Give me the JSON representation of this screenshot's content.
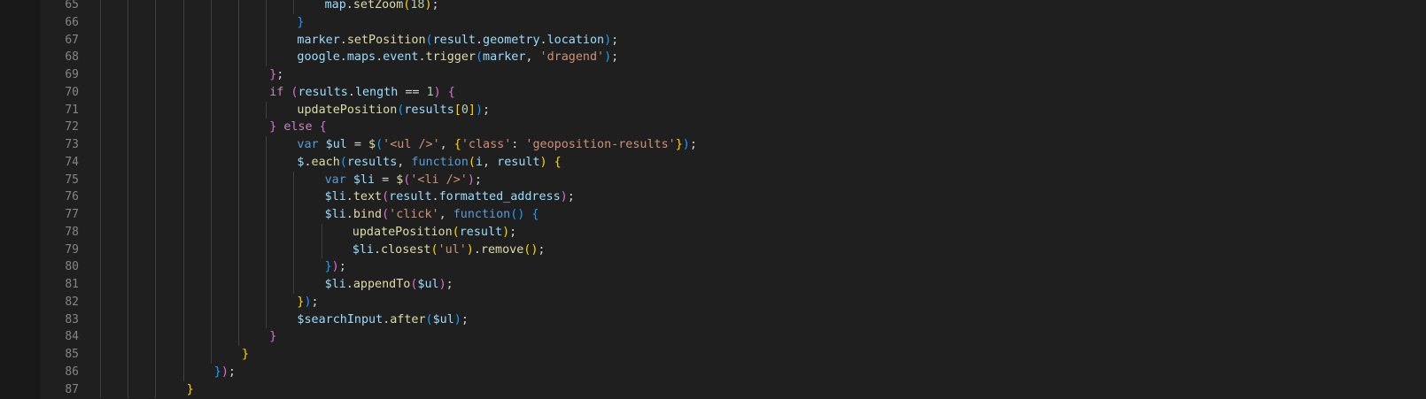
{
  "editor": {
    "language": "javascript",
    "theme": "dark",
    "lines": [
      {
        "num": "65",
        "indent": 8,
        "guides": [
          0,
          1,
          2,
          3,
          4,
          5,
          6,
          7
        ],
        "tokens": [
          {
            "t": "map",
            "c": "t-var"
          },
          {
            "t": ".",
            "c": ""
          },
          {
            "t": "setZoom",
            "c": "t-fn"
          },
          {
            "t": "(",
            "c": "b1"
          },
          {
            "t": "18",
            "c": "t-num"
          },
          {
            "t": ")",
            "c": "b1"
          },
          {
            "t": ";",
            "c": ""
          }
        ]
      },
      {
        "num": "66",
        "indent": 7,
        "guides": [
          0,
          1,
          2,
          3,
          4,
          5,
          6
        ],
        "tokens": [
          {
            "t": "}",
            "c": "b3"
          }
        ]
      },
      {
        "num": "67",
        "indent": 7,
        "guides": [
          0,
          1,
          2,
          3,
          4,
          5,
          6
        ],
        "tokens": [
          {
            "t": "marker",
            "c": "t-var"
          },
          {
            "t": ".",
            "c": ""
          },
          {
            "t": "setPosition",
            "c": "t-fn"
          },
          {
            "t": "(",
            "c": "b3"
          },
          {
            "t": "result",
            "c": "t-var"
          },
          {
            "t": ".",
            "c": ""
          },
          {
            "t": "geometry",
            "c": "t-var"
          },
          {
            "t": ".",
            "c": ""
          },
          {
            "t": "location",
            "c": "t-var"
          },
          {
            "t": ")",
            "c": "b3"
          },
          {
            "t": ";",
            "c": ""
          }
        ]
      },
      {
        "num": "68",
        "indent": 7,
        "guides": [
          0,
          1,
          2,
          3,
          4,
          5,
          6
        ],
        "tokens": [
          {
            "t": "google",
            "c": "t-var"
          },
          {
            "t": ".",
            "c": ""
          },
          {
            "t": "maps",
            "c": "t-var"
          },
          {
            "t": ".",
            "c": ""
          },
          {
            "t": "event",
            "c": "t-var"
          },
          {
            "t": ".",
            "c": ""
          },
          {
            "t": "trigger",
            "c": "t-fn"
          },
          {
            "t": "(",
            "c": "b3"
          },
          {
            "t": "marker",
            "c": "t-var"
          },
          {
            "t": ", ",
            "c": ""
          },
          {
            "t": "'dragend'",
            "c": "t-str"
          },
          {
            "t": ")",
            "c": "b3"
          },
          {
            "t": ";",
            "c": ""
          }
        ]
      },
      {
        "num": "69",
        "indent": 6,
        "guides": [
          0,
          1,
          2,
          3,
          4,
          5
        ],
        "tokens": [
          {
            "t": "}",
            "c": "b2"
          },
          {
            "t": ";",
            "c": ""
          }
        ]
      },
      {
        "num": "70",
        "indent": 6,
        "guides": [
          0,
          1,
          2,
          3,
          4,
          5
        ],
        "tokens": [
          {
            "t": "if",
            "c": "t-ctl"
          },
          {
            "t": " ",
            "c": ""
          },
          {
            "t": "(",
            "c": "b2"
          },
          {
            "t": "results",
            "c": "t-var"
          },
          {
            "t": ".",
            "c": ""
          },
          {
            "t": "length",
            "c": "t-var"
          },
          {
            "t": " == ",
            "c": ""
          },
          {
            "t": "1",
            "c": "t-num"
          },
          {
            "t": ")",
            "c": "b2"
          },
          {
            "t": " ",
            "c": ""
          },
          {
            "t": "{",
            "c": "b2"
          }
        ]
      },
      {
        "num": "71",
        "indent": 7,
        "guides": [
          0,
          1,
          2,
          3,
          4,
          5,
          6
        ],
        "tokens": [
          {
            "t": "updatePosition",
            "c": "t-fn"
          },
          {
            "t": "(",
            "c": "b3"
          },
          {
            "t": "results",
            "c": "t-var"
          },
          {
            "t": "[",
            "c": "b1"
          },
          {
            "t": "0",
            "c": "t-num"
          },
          {
            "t": "]",
            "c": "b1"
          },
          {
            "t": ")",
            "c": "b3"
          },
          {
            "t": ";",
            "c": ""
          }
        ]
      },
      {
        "num": "72",
        "indent": 6,
        "guides": [
          0,
          1,
          2,
          3,
          4,
          5
        ],
        "tokens": [
          {
            "t": "}",
            "c": "b2"
          },
          {
            "t": " ",
            "c": ""
          },
          {
            "t": "else",
            "c": "t-ctl"
          },
          {
            "t": " ",
            "c": ""
          },
          {
            "t": "{",
            "c": "b2"
          }
        ]
      },
      {
        "num": "73",
        "indent": 7,
        "guides": [
          0,
          1,
          2,
          3,
          4,
          5,
          6
        ],
        "tokens": [
          {
            "t": "var",
            "c": "t-kw"
          },
          {
            "t": " ",
            "c": ""
          },
          {
            "t": "$ul",
            "c": "t-var"
          },
          {
            "t": " = ",
            "c": ""
          },
          {
            "t": "$",
            "c": "t-fn"
          },
          {
            "t": "(",
            "c": "b3"
          },
          {
            "t": "'<ul />'",
            "c": "t-str"
          },
          {
            "t": ", ",
            "c": ""
          },
          {
            "t": "{",
            "c": "b1"
          },
          {
            "t": "'class'",
            "c": "t-str"
          },
          {
            "t": ": ",
            "c": ""
          },
          {
            "t": "'geoposition-results'",
            "c": "t-str"
          },
          {
            "t": "}",
            "c": "b1"
          },
          {
            "t": ")",
            "c": "b3"
          },
          {
            "t": ";",
            "c": ""
          }
        ]
      },
      {
        "num": "74",
        "indent": 7,
        "guides": [
          0,
          1,
          2,
          3,
          4,
          5,
          6
        ],
        "tokens": [
          {
            "t": "$",
            "c": "t-var"
          },
          {
            "t": ".",
            "c": ""
          },
          {
            "t": "each",
            "c": "t-fn"
          },
          {
            "t": "(",
            "c": "b3"
          },
          {
            "t": "results",
            "c": "t-var"
          },
          {
            "t": ", ",
            "c": ""
          },
          {
            "t": "function",
            "c": "t-kw"
          },
          {
            "t": "(",
            "c": "b1"
          },
          {
            "t": "i",
            "c": "t-var"
          },
          {
            "t": ", ",
            "c": ""
          },
          {
            "t": "result",
            "c": "t-var"
          },
          {
            "t": ")",
            "c": "b1"
          },
          {
            "t": " ",
            "c": ""
          },
          {
            "t": "{",
            "c": "b1"
          }
        ]
      },
      {
        "num": "75",
        "indent": 8,
        "guides": [
          0,
          1,
          2,
          3,
          4,
          5,
          6,
          7
        ],
        "tokens": [
          {
            "t": "var",
            "c": "t-kw"
          },
          {
            "t": " ",
            "c": ""
          },
          {
            "t": "$li",
            "c": "t-var"
          },
          {
            "t": " = ",
            "c": ""
          },
          {
            "t": "$",
            "c": "t-fn"
          },
          {
            "t": "(",
            "c": "b2"
          },
          {
            "t": "'<li />'",
            "c": "t-str"
          },
          {
            "t": ")",
            "c": "b2"
          },
          {
            "t": ";",
            "c": ""
          }
        ]
      },
      {
        "num": "76",
        "indent": 8,
        "guides": [
          0,
          1,
          2,
          3,
          4,
          5,
          6,
          7
        ],
        "tokens": [
          {
            "t": "$li",
            "c": "t-var"
          },
          {
            "t": ".",
            "c": ""
          },
          {
            "t": "text",
            "c": "t-fn"
          },
          {
            "t": "(",
            "c": "b2"
          },
          {
            "t": "result",
            "c": "t-var"
          },
          {
            "t": ".",
            "c": ""
          },
          {
            "t": "formatted_address",
            "c": "t-var"
          },
          {
            "t": ")",
            "c": "b2"
          },
          {
            "t": ";",
            "c": ""
          }
        ]
      },
      {
        "num": "77",
        "indent": 8,
        "guides": [
          0,
          1,
          2,
          3,
          4,
          5,
          6,
          7
        ],
        "tokens": [
          {
            "t": "$li",
            "c": "t-var"
          },
          {
            "t": ".",
            "c": ""
          },
          {
            "t": "bind",
            "c": "t-fn"
          },
          {
            "t": "(",
            "c": "b2"
          },
          {
            "t": "'click'",
            "c": "t-str"
          },
          {
            "t": ", ",
            "c": ""
          },
          {
            "t": "function",
            "c": "t-kw"
          },
          {
            "t": "(",
            "c": "b3"
          },
          {
            "t": ")",
            "c": "b3"
          },
          {
            "t": " ",
            "c": ""
          },
          {
            "t": "{",
            "c": "b3"
          }
        ]
      },
      {
        "num": "78",
        "indent": 9,
        "guides": [
          0,
          1,
          2,
          3,
          4,
          5,
          6,
          7,
          8
        ],
        "tokens": [
          {
            "t": "updatePosition",
            "c": "t-fn"
          },
          {
            "t": "(",
            "c": "b1"
          },
          {
            "t": "result",
            "c": "t-var"
          },
          {
            "t": ")",
            "c": "b1"
          },
          {
            "t": ";",
            "c": ""
          }
        ]
      },
      {
        "num": "79",
        "indent": 9,
        "guides": [
          0,
          1,
          2,
          3,
          4,
          5,
          6,
          7,
          8
        ],
        "tokens": [
          {
            "t": "$li",
            "c": "t-var"
          },
          {
            "t": ".",
            "c": ""
          },
          {
            "t": "closest",
            "c": "t-fn"
          },
          {
            "t": "(",
            "c": "b1"
          },
          {
            "t": "'ul'",
            "c": "t-str"
          },
          {
            "t": ")",
            "c": "b1"
          },
          {
            "t": ".",
            "c": ""
          },
          {
            "t": "remove",
            "c": "t-fn"
          },
          {
            "t": "(",
            "c": "b1"
          },
          {
            "t": ")",
            "c": "b1"
          },
          {
            "t": ";",
            "c": ""
          }
        ]
      },
      {
        "num": "80",
        "indent": 8,
        "guides": [
          0,
          1,
          2,
          3,
          4,
          5,
          6,
          7
        ],
        "tokens": [
          {
            "t": "}",
            "c": "b3"
          },
          {
            "t": ")",
            "c": "b2"
          },
          {
            "t": ";",
            "c": ""
          }
        ]
      },
      {
        "num": "81",
        "indent": 8,
        "guides": [
          0,
          1,
          2,
          3,
          4,
          5,
          6,
          7
        ],
        "tokens": [
          {
            "t": "$li",
            "c": "t-var"
          },
          {
            "t": ".",
            "c": ""
          },
          {
            "t": "appendTo",
            "c": "t-fn"
          },
          {
            "t": "(",
            "c": "b2"
          },
          {
            "t": "$ul",
            "c": "t-var"
          },
          {
            "t": ")",
            "c": "b2"
          },
          {
            "t": ";",
            "c": ""
          }
        ]
      },
      {
        "num": "82",
        "indent": 7,
        "guides": [
          0,
          1,
          2,
          3,
          4,
          5,
          6
        ],
        "tokens": [
          {
            "t": "}",
            "c": "b1"
          },
          {
            "t": ")",
            "c": "b3"
          },
          {
            "t": ";",
            "c": ""
          }
        ]
      },
      {
        "num": "83",
        "indent": 7,
        "guides": [
          0,
          1,
          2,
          3,
          4,
          5,
          6
        ],
        "tokens": [
          {
            "t": "$searchInput",
            "c": "t-var"
          },
          {
            "t": ".",
            "c": ""
          },
          {
            "t": "after",
            "c": "t-fn"
          },
          {
            "t": "(",
            "c": "b3"
          },
          {
            "t": "$ul",
            "c": "t-var"
          },
          {
            "t": ")",
            "c": "b3"
          },
          {
            "t": ";",
            "c": ""
          }
        ]
      },
      {
        "num": "84",
        "indent": 6,
        "guides": [
          0,
          1,
          2,
          3,
          4,
          5
        ],
        "tokens": [
          {
            "t": "}",
            "c": "b2"
          }
        ]
      },
      {
        "num": "85",
        "indent": 5,
        "guides": [
          0,
          1,
          2,
          3,
          4
        ],
        "tokens": [
          {
            "t": "}",
            "c": "b1"
          }
        ]
      },
      {
        "num": "86",
        "indent": 4,
        "guides": [
          0,
          1,
          2,
          3
        ],
        "tokens": [
          {
            "t": "}",
            "c": "b3"
          },
          {
            "t": ")",
            "c": "b2"
          },
          {
            "t": ";",
            "c": ""
          }
        ]
      },
      {
        "num": "87",
        "indent": 3,
        "guides": [
          0,
          1,
          2
        ],
        "tokens": [
          {
            "t": "}",
            "c": "b1"
          }
        ]
      }
    ]
  }
}
